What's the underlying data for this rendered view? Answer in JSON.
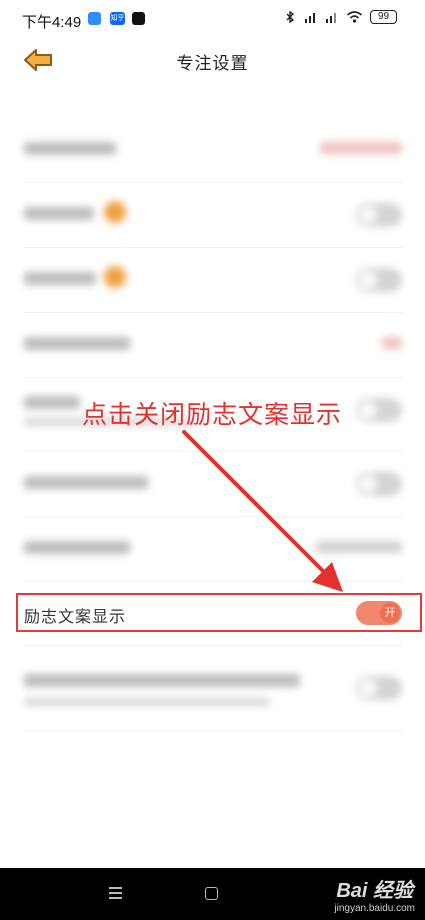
{
  "status_bar": {
    "time": "下午4:49",
    "zhihu_label": "知乎",
    "battery": "99",
    "signal_label": "HD"
  },
  "header": {
    "title": "专注设置",
    "back_icon": "back-arrow-icon"
  },
  "annotation": {
    "text": "点击关闭励志文案显示",
    "color": "#e53030"
  },
  "setting": {
    "label": "励志文案显示",
    "toggle_text": "开",
    "toggle_state": "on",
    "accent": "#ee6e4f"
  },
  "nav_bar": {
    "menu_icon": "menu-icon",
    "home_icon": "home-icon"
  },
  "watermark": {
    "main": "Bai 经验",
    "sub": "jingyan.baidu.com"
  }
}
